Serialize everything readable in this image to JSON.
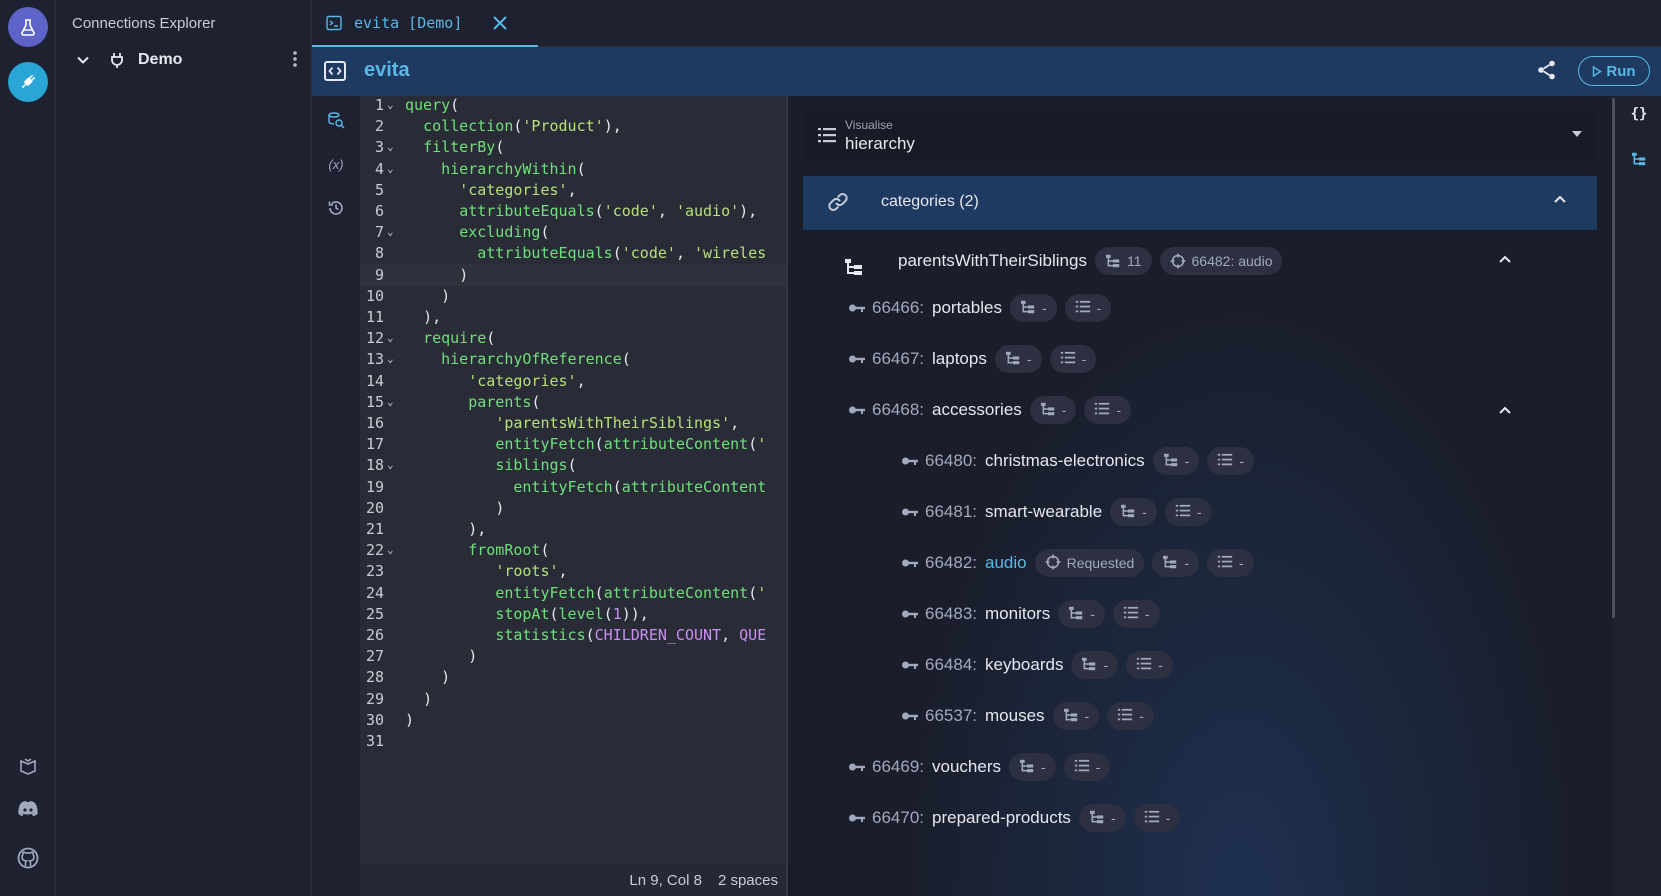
{
  "app": {
    "rail_icons": [
      "lab-flask-icon",
      "plug-icon",
      "book-icon",
      "discord-icon",
      "github-icon"
    ],
    "accent": "#58b8e6"
  },
  "explorer": {
    "title": "Connections Explorer",
    "connection": "Demo"
  },
  "tab": {
    "label": "evita [Demo]"
  },
  "toolbar": {
    "title": "evita",
    "run_label": "Run"
  },
  "editor": {
    "side_tools": [
      "search-icon",
      "variables-icon",
      "history-icon"
    ],
    "variables_glyph": "(x)",
    "lines": [
      {
        "n": "1",
        "fold": true,
        "html": "<span class=\"fn\">query</span><span class=\"pn\">(</span>"
      },
      {
        "n": "2",
        "fold": false,
        "html": "  <span class=\"fn\">collection</span><span class=\"pn\">(</span><span class=\"str\">'Product'</span><span class=\"pn\">),</span>"
      },
      {
        "n": "3",
        "fold": true,
        "html": "  <span class=\"fn\">filterBy</span><span class=\"pn\">(</span>"
      },
      {
        "n": "4",
        "fold": true,
        "html": "    <span class=\"fn\">hierarchyWithin</span><span class=\"pn\">(</span>"
      },
      {
        "n": "5",
        "fold": false,
        "html": "      <span class=\"str\">'categories'</span><span class=\"pn\">,</span>"
      },
      {
        "n": "6",
        "fold": false,
        "html": "      <span class=\"fn\">attributeEquals</span><span class=\"pn\">(</span><span class=\"str\">'code'</span><span class=\"pn\">, </span><span class=\"str\">'audio'</span><span class=\"pn\">),</span>"
      },
      {
        "n": "7",
        "fold": true,
        "html": "      <span class=\"fn\">excluding</span><span class=\"pn\">(</span>"
      },
      {
        "n": "8",
        "fold": false,
        "html": "        <span class=\"fn\">attributeEquals</span><span class=\"pn\">(</span><span class=\"str\">'code'</span><span class=\"pn\">, </span><span class=\"str\">'wireles</span>"
      },
      {
        "n": "9",
        "fold": false,
        "html": "      <span class=\"pn\">)</span>"
      },
      {
        "n": "10",
        "fold": false,
        "html": "    <span class=\"pn\">)</span>"
      },
      {
        "n": "11",
        "fold": false,
        "html": "  <span class=\"pn\">),</span>"
      },
      {
        "n": "12",
        "fold": true,
        "html": "  <span class=\"fn\">require</span><span class=\"pn\">(</span>"
      },
      {
        "n": "13",
        "fold": true,
        "html": "    <span class=\"fn\">hierarchyOfReference</span><span class=\"pn\">(</span>"
      },
      {
        "n": "14",
        "fold": false,
        "html": "       <span class=\"str\">'categories'</span><span class=\"pn\">,</span>"
      },
      {
        "n": "15",
        "fold": true,
        "html": "       <span class=\"fn\">parents</span><span class=\"pn\">(</span>"
      },
      {
        "n": "16",
        "fold": false,
        "html": "          <span class=\"str\">'parentsWithTheirSiblings'</span><span class=\"pn\">,</span>"
      },
      {
        "n": "17",
        "fold": false,
        "html": "          <span class=\"fn\">entityFetch</span><span class=\"pn\">(</span><span class=\"fn\">attributeContent</span><span class=\"pn\">(</span><span class=\"str\">'</span>"
      },
      {
        "n": "18",
        "fold": true,
        "html": "          <span class=\"fn\">siblings</span><span class=\"pn\">(</span>"
      },
      {
        "n": "19",
        "fold": false,
        "html": "            <span class=\"fn\">entityFetch</span><span class=\"pn\">(</span><span class=\"fn\">attributeContent</span>"
      },
      {
        "n": "20",
        "fold": false,
        "html": "          <span class=\"pn\">)</span>"
      },
      {
        "n": "21",
        "fold": false,
        "html": "       <span class=\"pn\">),</span>"
      },
      {
        "n": "22",
        "fold": true,
        "html": "       <span class=\"fn\">fromRoot</span><span class=\"pn\">(</span>"
      },
      {
        "n": "23",
        "fold": false,
        "html": "          <span class=\"str\">'roots'</span><span class=\"pn\">,</span>"
      },
      {
        "n": "24",
        "fold": false,
        "html": "          <span class=\"fn\">entityFetch</span><span class=\"pn\">(</span><span class=\"fn\">attributeContent</span><span class=\"pn\">(</span><span class=\"str\">'</span>"
      },
      {
        "n": "25",
        "fold": false,
        "html": "          <span class=\"fn\">stopAt</span><span class=\"pn\">(</span><span class=\"fn\">level</span><span class=\"pn\">(</span><span class=\"num\">1</span><span class=\"pn\">)),</span>"
      },
      {
        "n": "26",
        "fold": false,
        "html": "          <span class=\"fn\">statistics</span><span class=\"pn\">(</span><span class=\"cst\">CHILDREN_COUNT</span><span class=\"pn\">, </span><span class=\"cst\">QUE</span>"
      },
      {
        "n": "27",
        "fold": false,
        "html": "       <span class=\"pn\">)</span>"
      },
      {
        "n": "28",
        "fold": false,
        "html": "    <span class=\"pn\">)</span>"
      },
      {
        "n": "29",
        "fold": false,
        "html": "  <span class=\"pn\">)</span>"
      },
      {
        "n": "30",
        "fold": false,
        "html": "<span class=\"pn\">)</span>"
      },
      {
        "n": "31",
        "fold": false,
        "html": ""
      }
    ],
    "current_line": 9,
    "status_position": "Ln 9, Col 8",
    "status_indent": "2 spaces"
  },
  "results": {
    "visualise_caption": "Visualise",
    "visualise_value": "hierarchy",
    "reference_header": "categories (2)",
    "parents_label": "parentsWithTheirSiblings",
    "parents_children_count": "11",
    "parents_target": "66482: audio",
    "dash": "-",
    "requested_label": "Requested",
    "rows": [
      {
        "id": "66466",
        "name": "portables",
        "level": 0,
        "expanded": false,
        "requested": false
      },
      {
        "id": "66467",
        "name": "laptops",
        "level": 0,
        "expanded": false,
        "requested": false
      },
      {
        "id": "66468",
        "name": "accessories",
        "level": 0,
        "expanded": true,
        "requested": false
      },
      {
        "id": "66480",
        "name": "christmas-electronics",
        "level": 1,
        "expanded": false,
        "requested": false
      },
      {
        "id": "66481",
        "name": "smart-wearable",
        "level": 1,
        "expanded": false,
        "requested": false
      },
      {
        "id": "66482",
        "name": "audio",
        "level": 1,
        "expanded": false,
        "requested": true
      },
      {
        "id": "66483",
        "name": "monitors",
        "level": 1,
        "expanded": false,
        "requested": false
      },
      {
        "id": "66484",
        "name": "keyboards",
        "level": 1,
        "expanded": false,
        "requested": false
      },
      {
        "id": "66537",
        "name": "mouses",
        "level": 1,
        "expanded": false,
        "requested": false
      },
      {
        "id": "66469",
        "name": "vouchers",
        "level": 0,
        "expanded": false,
        "requested": false
      },
      {
        "id": "66470",
        "name": "prepared-products",
        "level": 0,
        "expanded": false,
        "requested": false
      }
    ]
  },
  "right_tools": {
    "json_glyph": "{}",
    "icons": [
      "json-braces-icon",
      "hierarchy-tree-icon"
    ]
  }
}
